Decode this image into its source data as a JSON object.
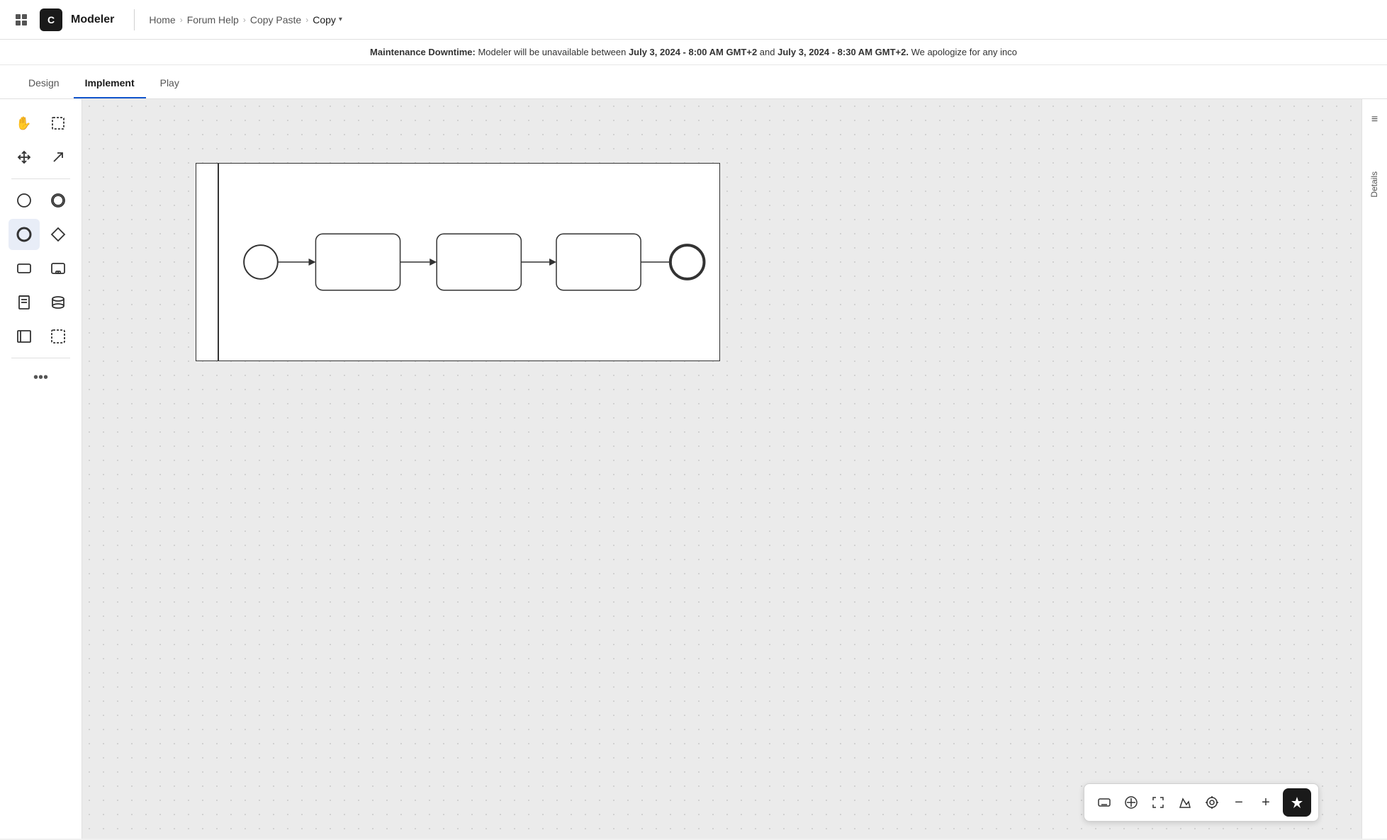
{
  "app": {
    "logo_text": "C",
    "name": "Modeler"
  },
  "breadcrumb": {
    "items": [
      {
        "label": "Home"
      },
      {
        "label": "Forum Help"
      },
      {
        "label": "Copy Paste"
      }
    ],
    "current": "Copy",
    "chevron": "▾"
  },
  "maintenance": {
    "prefix": "Maintenance Downtime:",
    "text1": " Modeler will be unavailable between ",
    "bold1": "July 3, 2024 - 8:00 AM GMT+2",
    "and_text": " and ",
    "bold2": "July 3, 2024 - 8:30 AM GMT+2.",
    "text2": " We apologize for any inco"
  },
  "tabs": [
    {
      "id": "design",
      "label": "Design",
      "active": false
    },
    {
      "id": "implement",
      "label": "Implement",
      "active": true
    },
    {
      "id": "play",
      "label": "Play",
      "active": false
    }
  ],
  "toolbar": {
    "tools": [
      {
        "row": 1,
        "items": [
          {
            "id": "hand",
            "icon": "✋",
            "tooltip": "Hand tool",
            "active": false
          },
          {
            "id": "select",
            "icon": "⊞",
            "tooltip": "Select tool",
            "active": false
          }
        ]
      },
      {
        "row": 2,
        "items": [
          {
            "id": "move",
            "icon": "⊕",
            "tooltip": "Move tool",
            "active": false
          },
          {
            "id": "arrow",
            "icon": "↗",
            "tooltip": "Arrow tool",
            "active": false
          }
        ]
      },
      {
        "row": 3,
        "items": [
          {
            "id": "start-event",
            "icon": "○",
            "tooltip": "Start event",
            "active": false
          },
          {
            "id": "intermediate-event",
            "icon": "◎",
            "tooltip": "Intermediate event",
            "active": false
          }
        ]
      },
      {
        "row": 4,
        "items": [
          {
            "id": "end-event",
            "icon": "⬤",
            "tooltip": "End event",
            "active": true
          },
          {
            "id": "gateway",
            "icon": "◇",
            "tooltip": "Gateway",
            "active": false
          }
        ]
      },
      {
        "row": 5,
        "items": [
          {
            "id": "task",
            "icon": "▭",
            "tooltip": "Task",
            "active": false
          },
          {
            "id": "subprocess",
            "icon": "⊟",
            "tooltip": "Subprocess",
            "active": false
          }
        ]
      },
      {
        "row": 6,
        "items": [
          {
            "id": "annotation",
            "icon": "📄",
            "tooltip": "Annotation",
            "active": false
          },
          {
            "id": "data-store",
            "icon": "🗄",
            "tooltip": "Data store",
            "active": false
          }
        ]
      },
      {
        "row": 7,
        "items": [
          {
            "id": "pool",
            "icon": "▤",
            "tooltip": "Pool",
            "active": false
          },
          {
            "id": "group",
            "icon": "⬚",
            "tooltip": "Group",
            "active": false
          }
        ]
      }
    ],
    "more_label": "•••"
  },
  "bottom_toolbar": {
    "keyboard_icon": "⌨",
    "connect_icon": "⊕",
    "expand_icon": "⛶",
    "map_icon": "⊡",
    "target_icon": "◎",
    "zoom_out": "−",
    "zoom_in": "+",
    "ai_icon": "✦"
  },
  "details_panel": {
    "label": "Details"
  },
  "sidebar_menu_icon": "≡"
}
